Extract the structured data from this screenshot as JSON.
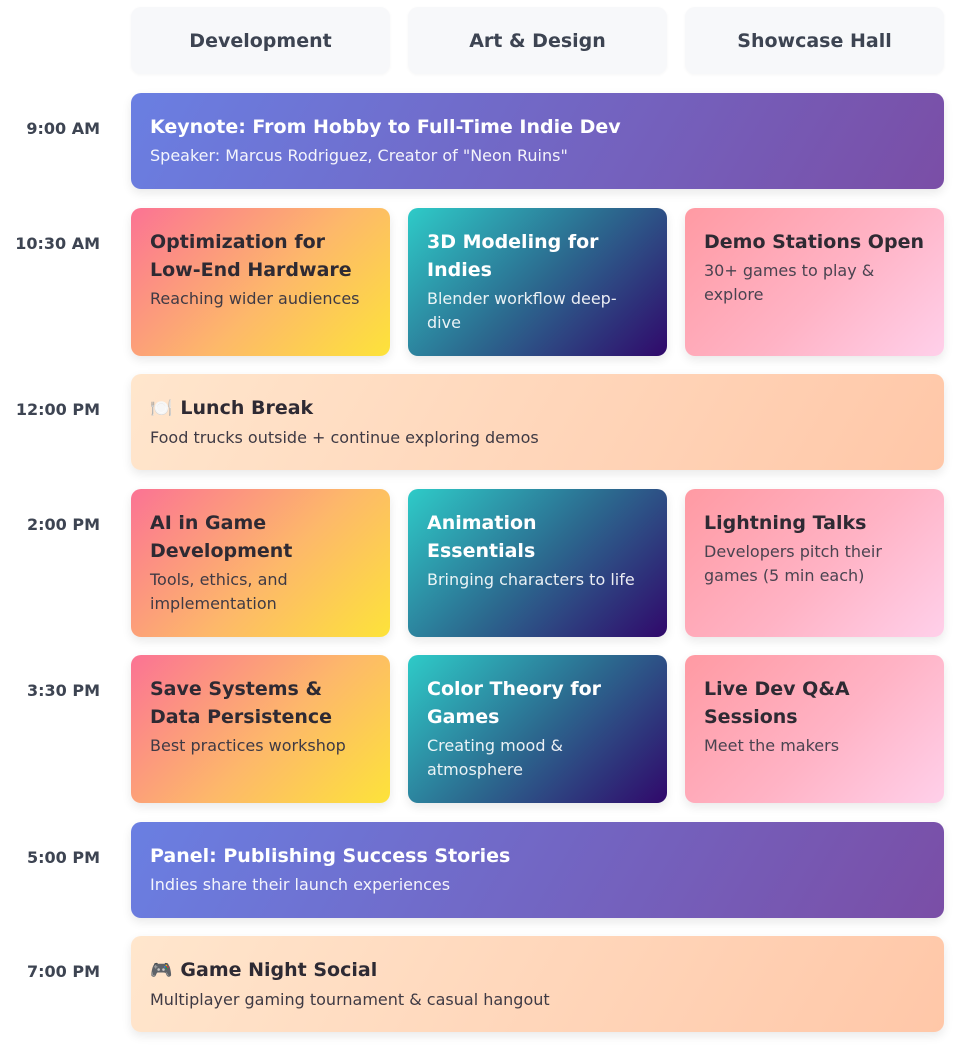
{
  "tracks": [
    "Development",
    "Art & Design",
    "Showcase Hall"
  ],
  "slots": {
    "s0900": {
      "time": "9:00 AM",
      "keynote": {
        "title": "Keynote: From Hobby to Full-Time Indie Dev",
        "desc": "Speaker: Marcus Rodriguez, Creator of \"Neon Ruins\""
      }
    },
    "s1030": {
      "time": "10:30 AM",
      "dev": {
        "title": "Optimization for Low-End Hardware",
        "desc": "Reaching wider audiences"
      },
      "art": {
        "title": "3D Modeling for Indies",
        "desc": "Blender workflow deep-dive"
      },
      "show": {
        "title": "Demo Stations Open",
        "desc": "30+ games to play & explore"
      }
    },
    "s1200": {
      "time": "12:00 PM",
      "lunch": {
        "icon": "🍽️",
        "title": "Lunch Break",
        "desc": "Food trucks outside + continue exploring demos"
      }
    },
    "s1400": {
      "time": "2:00 PM",
      "dev": {
        "title": "AI in Game Development",
        "desc": "Tools, ethics, and implementation"
      },
      "art": {
        "title": "Animation Essentials",
        "desc": "Bringing characters to life"
      },
      "show": {
        "title": "Lightning Talks",
        "desc": "Developers pitch their games (5 min each)"
      }
    },
    "s1530": {
      "time": "3:30 PM",
      "dev": {
        "title": "Save Systems & Data Persistence",
        "desc": "Best practices workshop"
      },
      "art": {
        "title": "Color Theory for Games",
        "desc": "Creating mood & atmosphere"
      },
      "show": {
        "title": "Live Dev Q&A Sessions",
        "desc": "Meet the makers"
      }
    },
    "s1700": {
      "time": "5:00 PM",
      "panel": {
        "title": "Panel: Publishing Success Stories",
        "desc": "Indies share their launch experiences"
      }
    },
    "s1900": {
      "time": "7:00 PM",
      "social": {
        "icon": "🎮",
        "title": "Game Night Social",
        "desc": "Multiplayer gaming tournament & casual hangout"
      }
    }
  },
  "colors": {
    "keynote": [
      "#6a7fe2",
      "#7a4ea6"
    ],
    "dev": [
      "#fb7394",
      "#fde33a"
    ],
    "art": [
      "#2ecbc8",
      "#30086b"
    ],
    "show": [
      "#ff9aa3",
      "#ffd0ea"
    ],
    "social": [
      "#ffe6cd",
      "#ffc7a8"
    ],
    "header_bg": "#f7f8fa",
    "text": "#3d4452"
  }
}
